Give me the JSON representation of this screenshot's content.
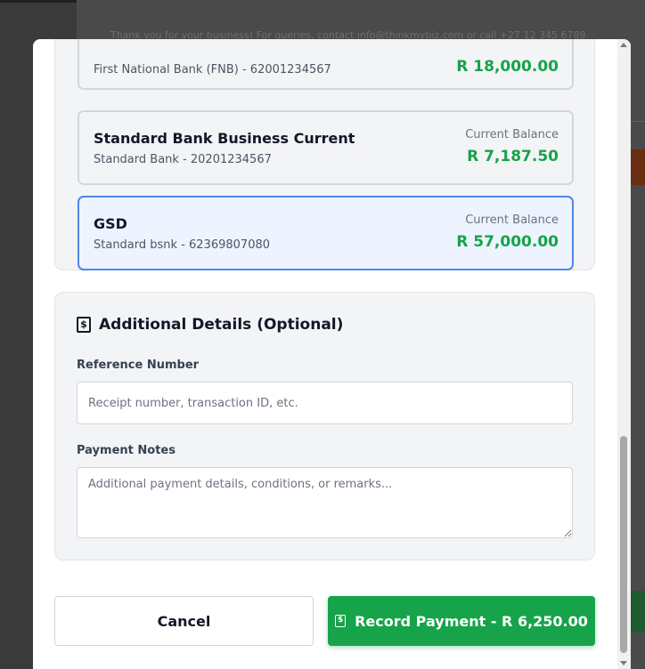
{
  "backdrop": {
    "footer_text": "Thank you for your business! For queries, contact info@thinkmybiz.com or call +27 12 345 6789"
  },
  "bank_accounts": [
    {
      "name": "",
      "bank_and_number": "First National Bank (FNB) - 62001234567",
      "balance_label": "",
      "balance": "R 18,000.00",
      "selected": false
    },
    {
      "name": "Standard Bank Business Current",
      "bank_and_number": "Standard Bank - 20201234567",
      "balance_label": "Current Balance",
      "balance": "R 7,187.50",
      "selected": false
    },
    {
      "name": "GSD",
      "bank_and_number": "Standard bsnk - 62369807080",
      "balance_label": "Current Balance",
      "balance": "R 57,000.00",
      "selected": true
    }
  ],
  "details": {
    "icon": "receipt-icon",
    "title": "Additional Details (Optional)",
    "reference_label": "Reference Number",
    "reference_placeholder": "Receipt number, transaction ID, etc.",
    "reference_value": "",
    "notes_label": "Payment Notes",
    "notes_placeholder": "Additional payment details, conditions, or remarks...",
    "notes_value": ""
  },
  "actions": {
    "cancel_label": "Cancel",
    "record_label": "Record Payment - R 6,250.00",
    "record_icon": "receipt-icon"
  },
  "colors": {
    "accent_green": "#16a34a",
    "selected_border": "#4d87e6",
    "selected_bg": "#edf4ff"
  }
}
